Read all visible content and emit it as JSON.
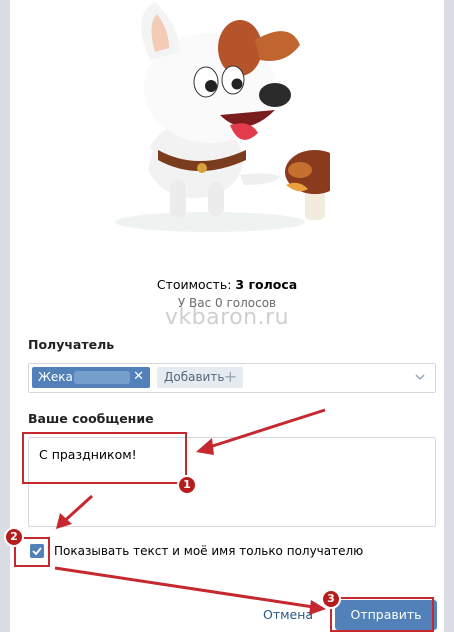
{
  "sticker": {
    "name": "dog-with-mushroom-sticker"
  },
  "cost": {
    "label": "Стоимость:",
    "value": "3 голоса"
  },
  "balance": {
    "text": "У Вас 0 голосов"
  },
  "watermark": {
    "text": "vkbaron.ru"
  },
  "recipient": {
    "label": "Получатель",
    "chip_name": "Жека",
    "add_label": "Добавить"
  },
  "message": {
    "label": "Ваше сообщение",
    "value": "С праздником!"
  },
  "privacy": {
    "checked": true,
    "label": "Показывать текст и моё имя только получателю"
  },
  "actions": {
    "cancel": "Отмена",
    "send": "Отправить"
  },
  "annotations": {
    "step1": "1",
    "step2": "2",
    "step3": "3"
  },
  "colors": {
    "accent": "#5181b8",
    "highlight": "#c5282f",
    "link": "#2a5885"
  }
}
